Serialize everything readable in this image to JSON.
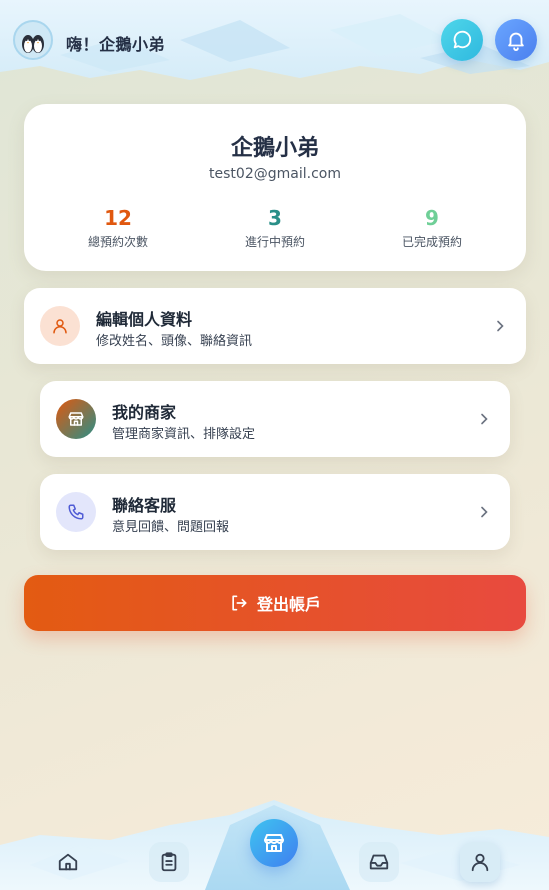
{
  "header": {
    "greeting": "嗨！企鵝小弟",
    "avatar_icon": "penguin-avatar-icon",
    "chat_icon": "chat-bubble-icon",
    "bell_icon": "bell-icon"
  },
  "profile": {
    "name": "企鵝小弟",
    "email": "test02@gmail.com",
    "stats": [
      {
        "value": "12",
        "label": "總預約次數",
        "color": "#e0580f"
      },
      {
        "value": "3",
        "label": "進行中預約",
        "color": "#2a8f88"
      },
      {
        "value": "9",
        "label": "已完成預約",
        "color": "#6fcf97"
      }
    ]
  },
  "menu": [
    {
      "title": "編輯個人資料",
      "subtitle": "修改姓名、頭像、聯絡資訊",
      "icon": "user-icon"
    },
    {
      "title": "我的商家",
      "subtitle": "管理商家資訊、排隊設定",
      "icon": "store-icon"
    },
    {
      "title": "聯絡客服",
      "subtitle": "意見回饋、問題回報",
      "icon": "phone-icon"
    }
  ],
  "logout": {
    "label": "登出帳戶",
    "icon": "logout-icon"
  },
  "bottom_nav": [
    {
      "icon": "home-icon"
    },
    {
      "icon": "clipboard-icon"
    },
    {
      "icon": "store-icon"
    },
    {
      "icon": "inbox-icon"
    },
    {
      "icon": "user-icon"
    }
  ],
  "colors": {
    "accent_orange": "#e35b12",
    "accent_red": "#e84a3f",
    "accent_blue": "#4b7fee",
    "accent_cyan": "#2fb9df"
  }
}
